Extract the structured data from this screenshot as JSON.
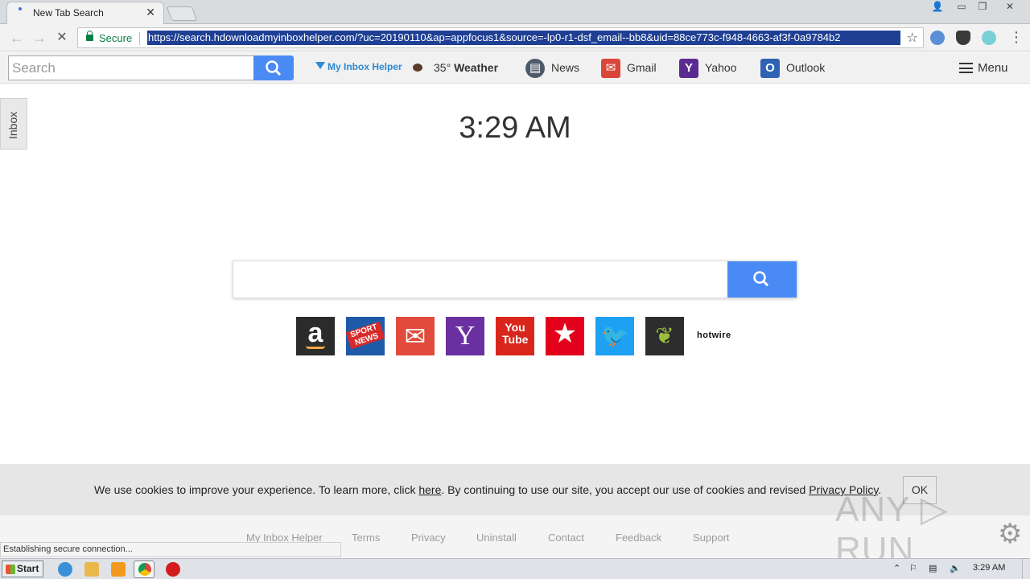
{
  "browser": {
    "tab_title": "New Tab Search",
    "tab_close": "✕",
    "window_controls": [
      "👤",
      "▭",
      "❐",
      "✕"
    ],
    "secure_label": "Secure",
    "url": "https://search.hdownloadmyinboxhelper.com/?uc=20190110&ap=appfocus1&source=-lp0-r1-dsf_email--bb8&uid=88ce773c-f948-4663-af3f-0a9784b2",
    "back_icon": "back-arrow-icon",
    "forward_icon": "forward-arrow-icon",
    "stop_icon": "stop-icon"
  },
  "pagebar": {
    "search_placeholder": "Search",
    "brand": "My Inbox Helper",
    "weather_temp": "35°",
    "weather_label": "Weather",
    "links": [
      "News",
      "Gmail",
      "Yahoo",
      "Outlook"
    ],
    "menu_label": "Menu"
  },
  "side_tab": "Inbox",
  "clock": "3:29 AM",
  "quick_links": [
    {
      "name": "amazon",
      "bg": "#2b2b2b",
      "glyph": "a"
    },
    {
      "name": "sport-news",
      "bg": "#1f5aa8",
      "glyph": "SPORT NEWS"
    },
    {
      "name": "gmail",
      "bg": "#e24b3b",
      "glyph": "✉"
    },
    {
      "name": "yahoo",
      "bg": "#6a2fa0",
      "glyph": "Y"
    },
    {
      "name": "youtube",
      "bg": "#d9261c",
      "glyph": "You Tube"
    },
    {
      "name": "macys",
      "bg": "#e2001a",
      "glyph": "★"
    },
    {
      "name": "twitter",
      "bg": "#1da1f2",
      "glyph": "🐦"
    },
    {
      "name": "ancestry",
      "bg": "#2d2d2d",
      "glyph": "❦"
    }
  ],
  "hotwire_label": "hotwire",
  "cookie": {
    "text_before": "We use cookies to improve your experience. To learn more, click ",
    "here": "here",
    "text_middle": ". By continuing to use our site, you accept our use of cookies and revised ",
    "policy": "Privacy Policy",
    "text_end": ".",
    "ok": "OK"
  },
  "footer_links": [
    "My Inbox Helper",
    "Terms",
    "Privacy",
    "Uninstall",
    "Contact",
    "Feedback",
    "Support"
  ],
  "status_text": "Establishing secure connection...",
  "watermark": "ANY ▷ RUN",
  "taskbar": {
    "start": "Start",
    "time": "3:29 AM"
  },
  "colors": {
    "accent": "#4a8af4",
    "secure": "#0b8043",
    "url_highlight": "#1e3f93"
  }
}
